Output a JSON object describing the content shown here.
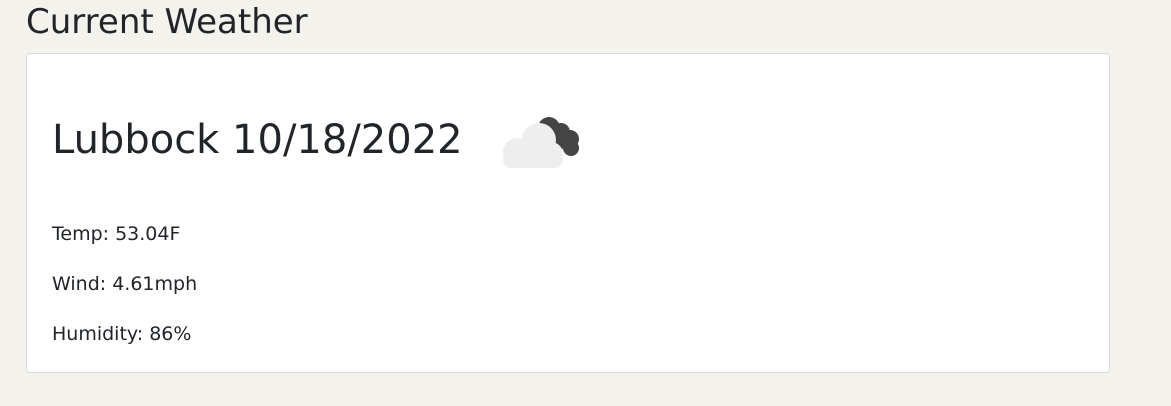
{
  "section": {
    "title": "Current Weather"
  },
  "current": {
    "heading": "Lubbock 10/18/2022",
    "icon": "cloudy-night-icon",
    "temp": "Temp: 53.04F",
    "wind": "Wind: 4.61mph",
    "humidity": "Humidity: 86%"
  }
}
